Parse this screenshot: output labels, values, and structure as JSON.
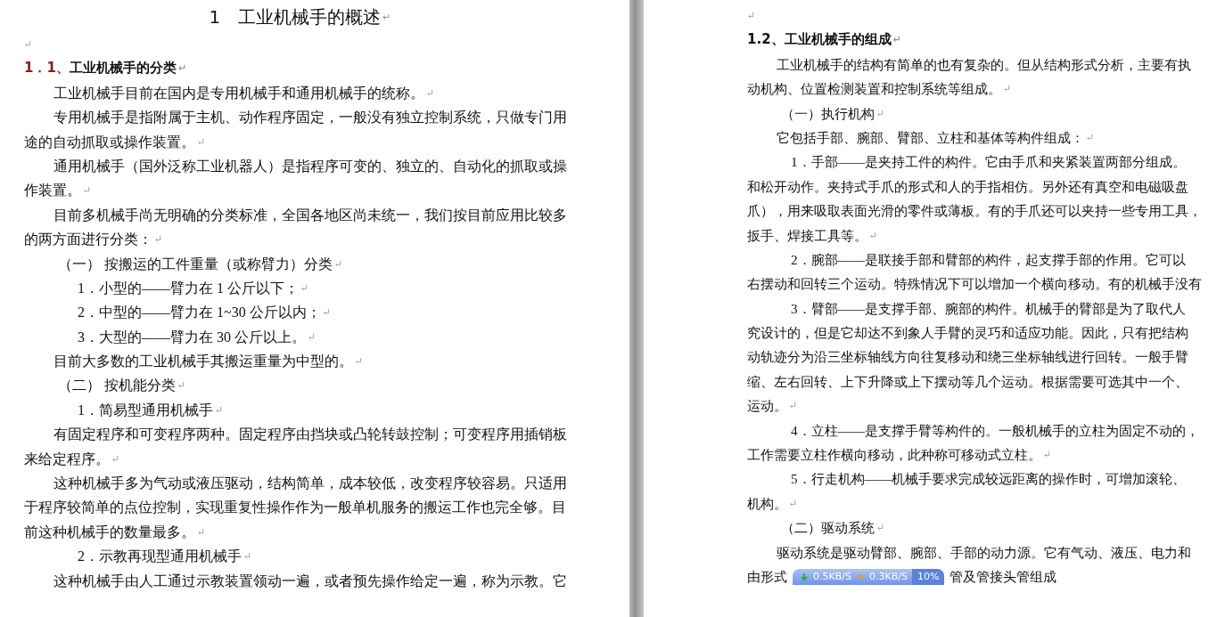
{
  "pages": [
    {
      "lines": [
        {
          "kind": "title",
          "text": "1　工业机械手的概述",
          "mark": "↵"
        },
        {
          "kind": "blank",
          "mark": "↵"
        },
        {
          "kind": "heading",
          "number": "1．1、",
          "text": "工业机械手的分类",
          "mark": "↵"
        },
        {
          "kind": "indent",
          "text": "工业机械手目前在国内是专用机械手和通用机械手的统称。",
          "mark": "↵"
        },
        {
          "kind": "indent",
          "text": "专用机械手是指附属于主机、动作程序固定，一般没有独立控制系统，只做专门用"
        },
        {
          "kind": "plain",
          "text": "途的自动抓取或操作装置。",
          "mark": "↵"
        },
        {
          "kind": "indent",
          "text": "通用机械手（国外泛称工业机器人）是指程序可变的、独立的、自动化的抓取或操"
        },
        {
          "kind": "plain",
          "text": "作装置。",
          "mark": "↵"
        },
        {
          "kind": "indent",
          "text": "目前多机械手尚无明确的分类标准，全国各地区尚未统一，我们按目前应用比较多"
        },
        {
          "kind": "plain",
          "text": "的两方面进行分类：",
          "mark": "↵"
        },
        {
          "kind": "sub",
          "text": "（一） 按搬运的工件重量（或称臂力）分类",
          "mark": "↵"
        },
        {
          "kind": "item",
          "text": "1．小型的——臂力在 1 公斤以下；",
          "mark": "↵"
        },
        {
          "kind": "item",
          "text": "2．中型的——臂力在 1~30 公斤以内；",
          "mark": "↵"
        },
        {
          "kind": "item",
          "text": "3．大型的——臂力在 30 公斤以上。",
          "mark": "↵"
        },
        {
          "kind": "indent",
          "text": "目前大多数的工业机械手其搬运重量为中型的。",
          "mark": "↵"
        },
        {
          "kind": "sub",
          "text": "（二） 按机能分类",
          "mark": "↵"
        },
        {
          "kind": "item",
          "text": "1．简易型通用机械手",
          "mark": "↵"
        },
        {
          "kind": "indent",
          "text": "有固定程序和可变程序两种。固定程序由挡块或凸轮转鼓控制；可变程序用插销板"
        },
        {
          "kind": "plain",
          "text": "来给定程序。",
          "mark": "↵"
        },
        {
          "kind": "indent",
          "text": "这种机械手多为气动或液压驱动，结构简单，成本较低，改变程序较容易。只适用"
        },
        {
          "kind": "plain",
          "text": "于程序较简单的点位控制，实现重复性操作作为一般单机服务的搬运工作也完全够。目"
        },
        {
          "kind": "plain",
          "text": "前这种机械手的数量最多。",
          "mark": "↵"
        },
        {
          "kind": "item",
          "text": "2．示教再现型通用机械手",
          "mark": "↵"
        },
        {
          "kind": "indent",
          "text": "这种机械手由人工通过示教装置领动一遍，或者预先操作给定一遍，称为示教。它"
        }
      ]
    },
    {
      "lines": [
        {
          "kind": "blank",
          "mark": "↵"
        },
        {
          "kind": "heading",
          "number": "1.2、",
          "text": "工业机械手的组成",
          "mark": "↵"
        },
        {
          "kind": "indent",
          "text": "工业机械手的结构有简单的也有复杂的。但从结构形式分析，主要有执"
        },
        {
          "kind": "plain",
          "text": "动机构、位置检测装置和控制系统等组成。",
          "mark": "↵"
        },
        {
          "kind": "sub",
          "text": "（一）执行机构",
          "mark": "↵"
        },
        {
          "kind": "indent",
          "text": "它包括手部、腕部、臂部、立柱和基体等构件组成：",
          "mark": "↵"
        },
        {
          "kind": "item",
          "text": "1．手部——是夹持工件的构件。它由手爪和夹紧装置两部分组成。"
        },
        {
          "kind": "plain",
          "text": "和松开动作。夹持式手爪的形式和人的手指相仿。另外还有真空和电磁吸盘"
        },
        {
          "kind": "plain",
          "text": "爪），用来吸取表面光滑的零件或薄板。有的手爪还可以夹持一些专用工具，"
        },
        {
          "kind": "plain",
          "text": "扳手、焊接工具等。",
          "mark": "↵"
        },
        {
          "kind": "item",
          "text": "2．腕部——是联接手部和臂部的构件，起支撑手部的作用。它可以"
        },
        {
          "kind": "plain",
          "text": "右摆动和回转三个运动。特殊情况下可以增加一个横向移动。有的机械手没有"
        },
        {
          "kind": "item",
          "text": "3．臂部——是支撑手部、腕部的构件。机械手的臂部是为了取代人"
        },
        {
          "kind": "plain",
          "text": "究设计的，但是它却达不到象人手臂的灵巧和适应功能。因此，只有把结构"
        },
        {
          "kind": "plain",
          "text": "动轨迹分为沿三坐标轴线方向往复移动和绕三坐标轴线进行回转。一般手臂"
        },
        {
          "kind": "plain",
          "text": "缩、左右回转、上下升降或上下摆动等几个运动。根据需要可选其中一个、"
        },
        {
          "kind": "plain",
          "text": "运动。",
          "mark": "↵"
        },
        {
          "kind": "item",
          "text": "4．立柱——是支撑手臂等构件的。一般机械手的立柱为固定不动的，"
        },
        {
          "kind": "plain",
          "text": "工作需要立柱作横向移动，此种称可移动式立柱。",
          "mark": "↵"
        },
        {
          "kind": "item",
          "text": "5．行走机构——机械手要求完成较远距离的操作时，可增加滚轮、"
        },
        {
          "kind": "plain",
          "text": "机构。",
          "mark": "↵"
        },
        {
          "kind": "sub",
          "text": "（二）驱动系统",
          "mark": "↵"
        },
        {
          "kind": "indent",
          "text": "驱动系统是驱动臂部、腕部、手部的动力源。它有气动、液压、电力和"
        },
        {
          "kind": "covered",
          "before": "由形式",
          "after": "管及管接头管组成",
          "widget": {
            "down": "0.5KB/S",
            "up": "0.3KB/S",
            "cpu": "10%"
          }
        }
      ]
    }
  ]
}
